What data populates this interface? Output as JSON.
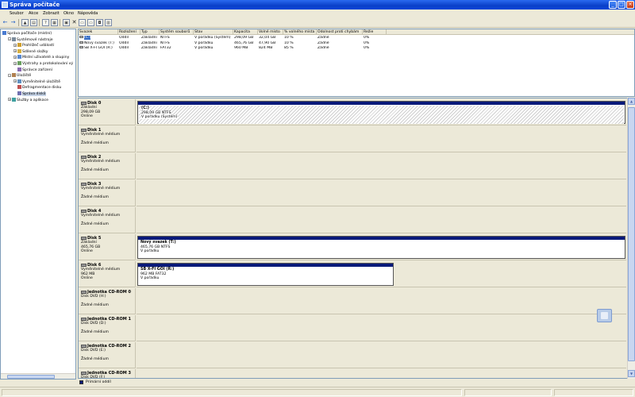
{
  "window": {
    "title": "Správa počítače"
  },
  "menu": [
    "Soubor",
    "Akce",
    "Zobrazit",
    "Okno",
    "Nápověda"
  ],
  "tree": [
    {
      "label": "Správa počítače (místní)",
      "level": 0,
      "expander": "",
      "icon": "computer-icon"
    },
    {
      "label": "Systémové nástroje",
      "level": 1,
      "expander": "−",
      "icon": "tools-icon"
    },
    {
      "label": "Prohlížeč událostí",
      "level": 2,
      "expander": "+",
      "icon": "event-viewer-icon"
    },
    {
      "label": "Sdílené složky",
      "level": 2,
      "expander": "+",
      "icon": "shared-folder-icon"
    },
    {
      "label": "Místní uživatelé a skupiny",
      "level": 2,
      "expander": "+",
      "icon": "users-icon"
    },
    {
      "label": "Výstrahy a protokolování vý",
      "level": 2,
      "expander": "+",
      "icon": "alerts-icon"
    },
    {
      "label": "Správce zařízení",
      "level": 2,
      "expander": "",
      "icon": "device-manager-icon"
    },
    {
      "label": "Úložiště",
      "level": 1,
      "expander": "−",
      "icon": "storage-icon"
    },
    {
      "label": "Vyměnitelné úložiště",
      "level": 2,
      "expander": "+",
      "icon": "removable-storage-icon"
    },
    {
      "label": "Defragmentace disku",
      "level": 2,
      "expander": "",
      "icon": "defrag-icon"
    },
    {
      "label": "Správa disků",
      "level": 2,
      "expander": "",
      "icon": "disk-management-icon",
      "selected": true
    },
    {
      "label": "Služby a aplikace",
      "level": 1,
      "expander": "+",
      "icon": "services-icon"
    }
  ],
  "volumes": {
    "columns": [
      "Svazek",
      "Rozložení",
      "Typ",
      "Systém souborů",
      "Stav",
      "Kapacita",
      "Volné místo",
      "% volného místa",
      "Odolnost proti chybám",
      "Režie"
    ],
    "rows": [
      [
        "(C:)",
        "Oddíl",
        "Základní",
        "NTFS",
        "V pořádku (Systém)",
        "298,09 GB",
        "32,04 GB",
        "10 %",
        "Žádné",
        "0%"
      ],
      [
        "Nový svazek (T:)",
        "Oddíl",
        "Základní",
        "NTFS",
        "V pořádku",
        "465,76 GB",
        "47,90 GB",
        "10 %",
        "Žádné",
        "0%"
      ],
      [
        "SB X-FI GOI (R:)",
        "Oddíl",
        "Základní",
        "FAT32",
        "V pořádku",
        "960 MB",
        "824 MB",
        "85 %",
        "Žádné",
        "0%"
      ]
    ]
  },
  "disks": [
    {
      "name": "Disk 0",
      "lines": [
        "Základní",
        "298,09 GB",
        "Online"
      ],
      "partition": {
        "title": "(C:)",
        "lines": [
          "298,09 GB NTFS",
          "V pořádku (Systém)"
        ],
        "fill": 1.0,
        "hatched": true
      }
    },
    {
      "name": "Disk 1",
      "lines": [
        "Vyměnitelné médium",
        "",
        "Žádné médium"
      ]
    },
    {
      "name": "Disk 2",
      "lines": [
        "Vyměnitelné médium",
        "",
        "Žádné médium"
      ]
    },
    {
      "name": "Disk 3",
      "lines": [
        "Vyměnitelné médium",
        "",
        "Žádné médium"
      ]
    },
    {
      "name": "Disk 4",
      "lines": [
        "Vyměnitelné médium",
        "",
        "Žádné médium"
      ]
    },
    {
      "name": "Disk 5",
      "lines": [
        "Základní",
        "465,76 GB",
        "Online"
      ],
      "partition": {
        "title": "Nový svazek  (T:)",
        "lines": [
          "465,76 GB NTFS",
          "V pořádku"
        ],
        "fill": 1.0,
        "hatched": false
      }
    },
    {
      "name": "Disk 6",
      "lines": [
        "Vyměnitelné médium",
        "962 MB",
        "Online"
      ],
      "partition": {
        "title": "SB X-FI GOI  (R:)",
        "lines": [
          "962 MB FAT32",
          "V pořádku"
        ],
        "fill": 0.525,
        "hatched": false
      }
    },
    {
      "name": "Jednotka CD-ROM 0",
      "lines": [
        "Disk DVD (H:)",
        "",
        "Žádné médium"
      ]
    },
    {
      "name": "Jednotka CD-ROM 1",
      "lines": [
        "Disk DVD (D:)",
        "",
        "Žádné médium"
      ]
    },
    {
      "name": "Jednotka CD-ROM 2",
      "lines": [
        "Disk DVD (E:)",
        "",
        "Žádné médium"
      ]
    },
    {
      "name": "Jednotka CD-ROM 3",
      "lines": [
        "Disk DVD (F:)",
        "",
        ""
      ]
    }
  ],
  "legend": {
    "label": "Primární oddíl",
    "color": "#0a1a7a"
  }
}
